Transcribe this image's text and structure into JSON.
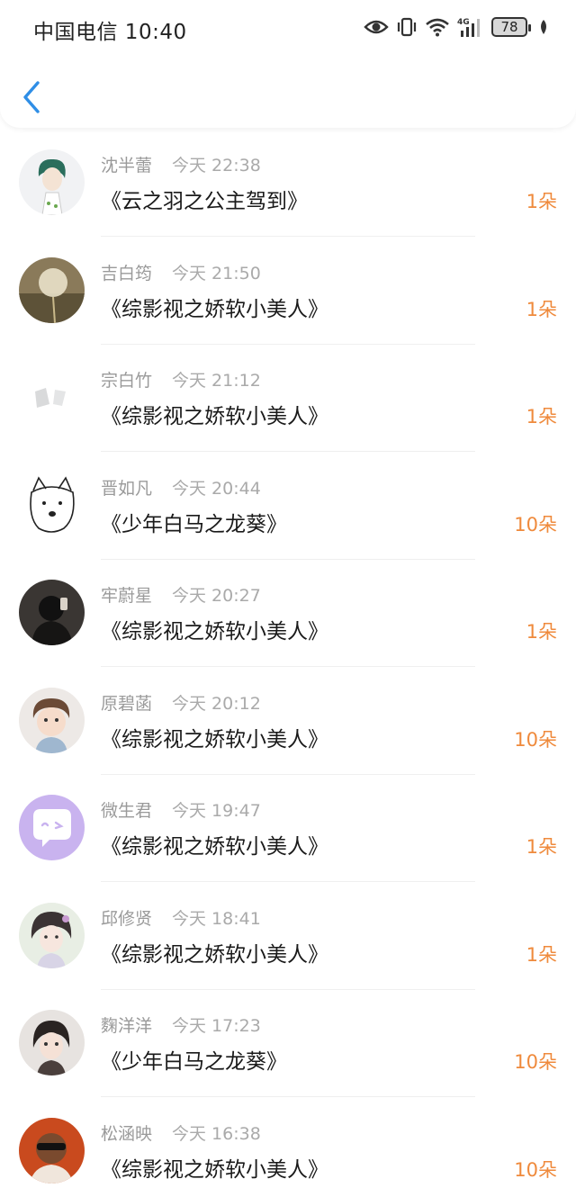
{
  "status_bar": {
    "carrier_time": "中国电信 10:40",
    "battery": "78",
    "network": "4G"
  },
  "header": {
    "back_icon": "chevron-left-icon",
    "back_color": "#2f8ee6"
  },
  "colors": {
    "count": "#ef8a3c",
    "name": "#9a9a9a",
    "title": "#1a1a1a"
  },
  "records": [
    {
      "name": "沈半蕾",
      "time": "今天 22:38",
      "book": "《云之羽之公主驾到》",
      "count": "1朵"
    },
    {
      "name": "吉白筠",
      "time": "今天 21:50",
      "book": "《综影视之娇软小美人》",
      "count": "1朵"
    },
    {
      "name": "宗白竹",
      "time": "今天 21:12",
      "book": "《综影视之娇软小美人》",
      "count": "1朵"
    },
    {
      "name": "晋如凡",
      "time": "今天 20:44",
      "book": "《少年白马之龙葵》",
      "count": "10朵"
    },
    {
      "name": "牢蔚星",
      "time": "今天 20:27",
      "book": "《综影视之娇软小美人》",
      "count": "1朵"
    },
    {
      "name": "原碧菡",
      "time": "今天 20:12",
      "book": "《综影视之娇软小美人》",
      "count": "10朵"
    },
    {
      "name": "微生君",
      "time": "今天 19:47",
      "book": "《综影视之娇软小美人》",
      "count": "1朵"
    },
    {
      "name": "邱修贤",
      "time": "今天 18:41",
      "book": "《综影视之娇软小美人》",
      "count": "1朵"
    },
    {
      "name": "麴洋洋",
      "time": "今天 17:23",
      "book": "《少年白马之龙葵》",
      "count": "10朵"
    },
    {
      "name": "松涵映",
      "time": "今天 16:38",
      "book": "《综影视之娇软小美人》",
      "count": "10朵"
    }
  ]
}
